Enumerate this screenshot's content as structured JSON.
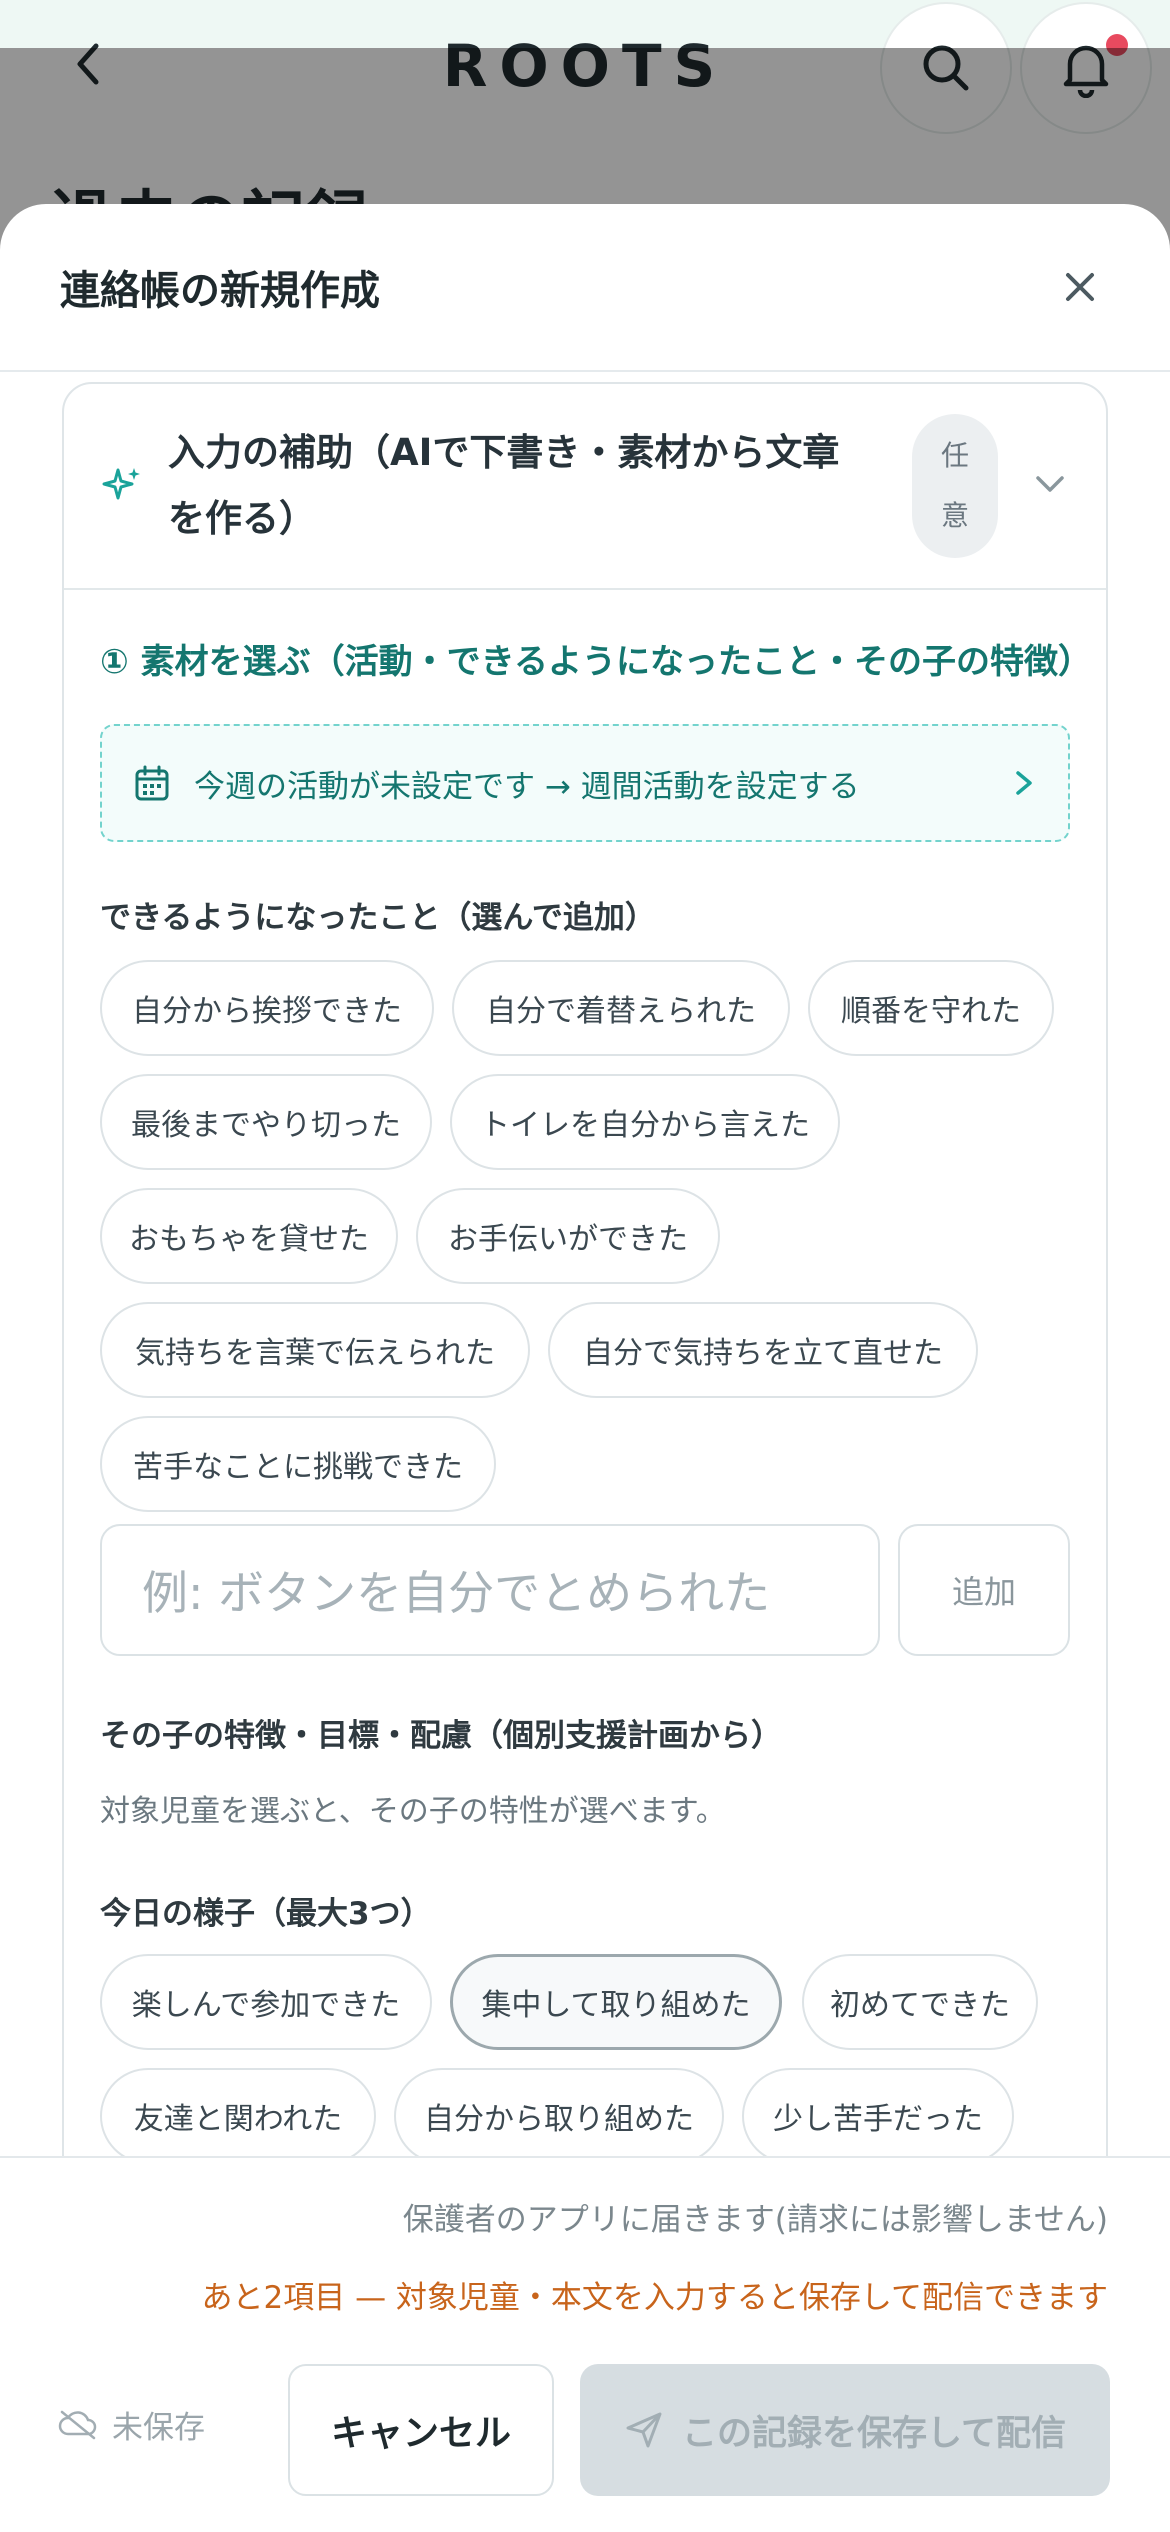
{
  "app": {
    "logo": "ROOTS",
    "page_title": "過去の記録"
  },
  "modal": {
    "title": "連絡帳の新規作成",
    "assist": {
      "label": "入力の補助（AIで下書き・素材から文章を作る）",
      "optional_line1": "任",
      "optional_line2": "意"
    },
    "step1_heading": "① 素材を選ぶ（活動・できるようになったこと・その子の特徴）",
    "activity_link": "今週の活動が未設定です → 週間活動を設定する",
    "achievements": {
      "label": "できるようになったこと（選んで追加）",
      "chips": [
        "自分から挨拶できた",
        "自分で着替えられた",
        "順番を守れた",
        "最後までやり切った",
        "トイレを自分から言えた",
        "おもちゃを貸せた",
        "お手伝いができた",
        "気持ちを言葉で伝えられた",
        "自分で気持ちを立て直せた",
        "苦手なことに挑戦できた"
      ],
      "input_placeholder": "例: ボタンを自分でとめられた",
      "add_label": "追加"
    },
    "traits": {
      "label": "その子の特徴・目標・配慮（個別支援計画から）",
      "hint": "対象児童を選ぶと、その子の特性が選べます。"
    },
    "today": {
      "label": "今日の様子（最大3つ）",
      "chips": [
        "楽しんで参加できた",
        "集中して取り組めた",
        "初めてできた",
        "友達と関われた",
        "自分から取り組めた",
        "少し苦手だった"
      ],
      "selected": "集中して取り組めた"
    },
    "footer": {
      "note": "保護者のアプリに届きます(請求には影響しません)",
      "warning": "あと2項目 — 対象児童・本文を入力すると保存して配信できます",
      "unsaved": "未保存",
      "cancel": "キャンセル",
      "submit": "この記録を保存して配信"
    }
  },
  "colors": {
    "accent": "#14766f",
    "warning": "#c8641b",
    "notification_dot": "#e84a5f"
  }
}
